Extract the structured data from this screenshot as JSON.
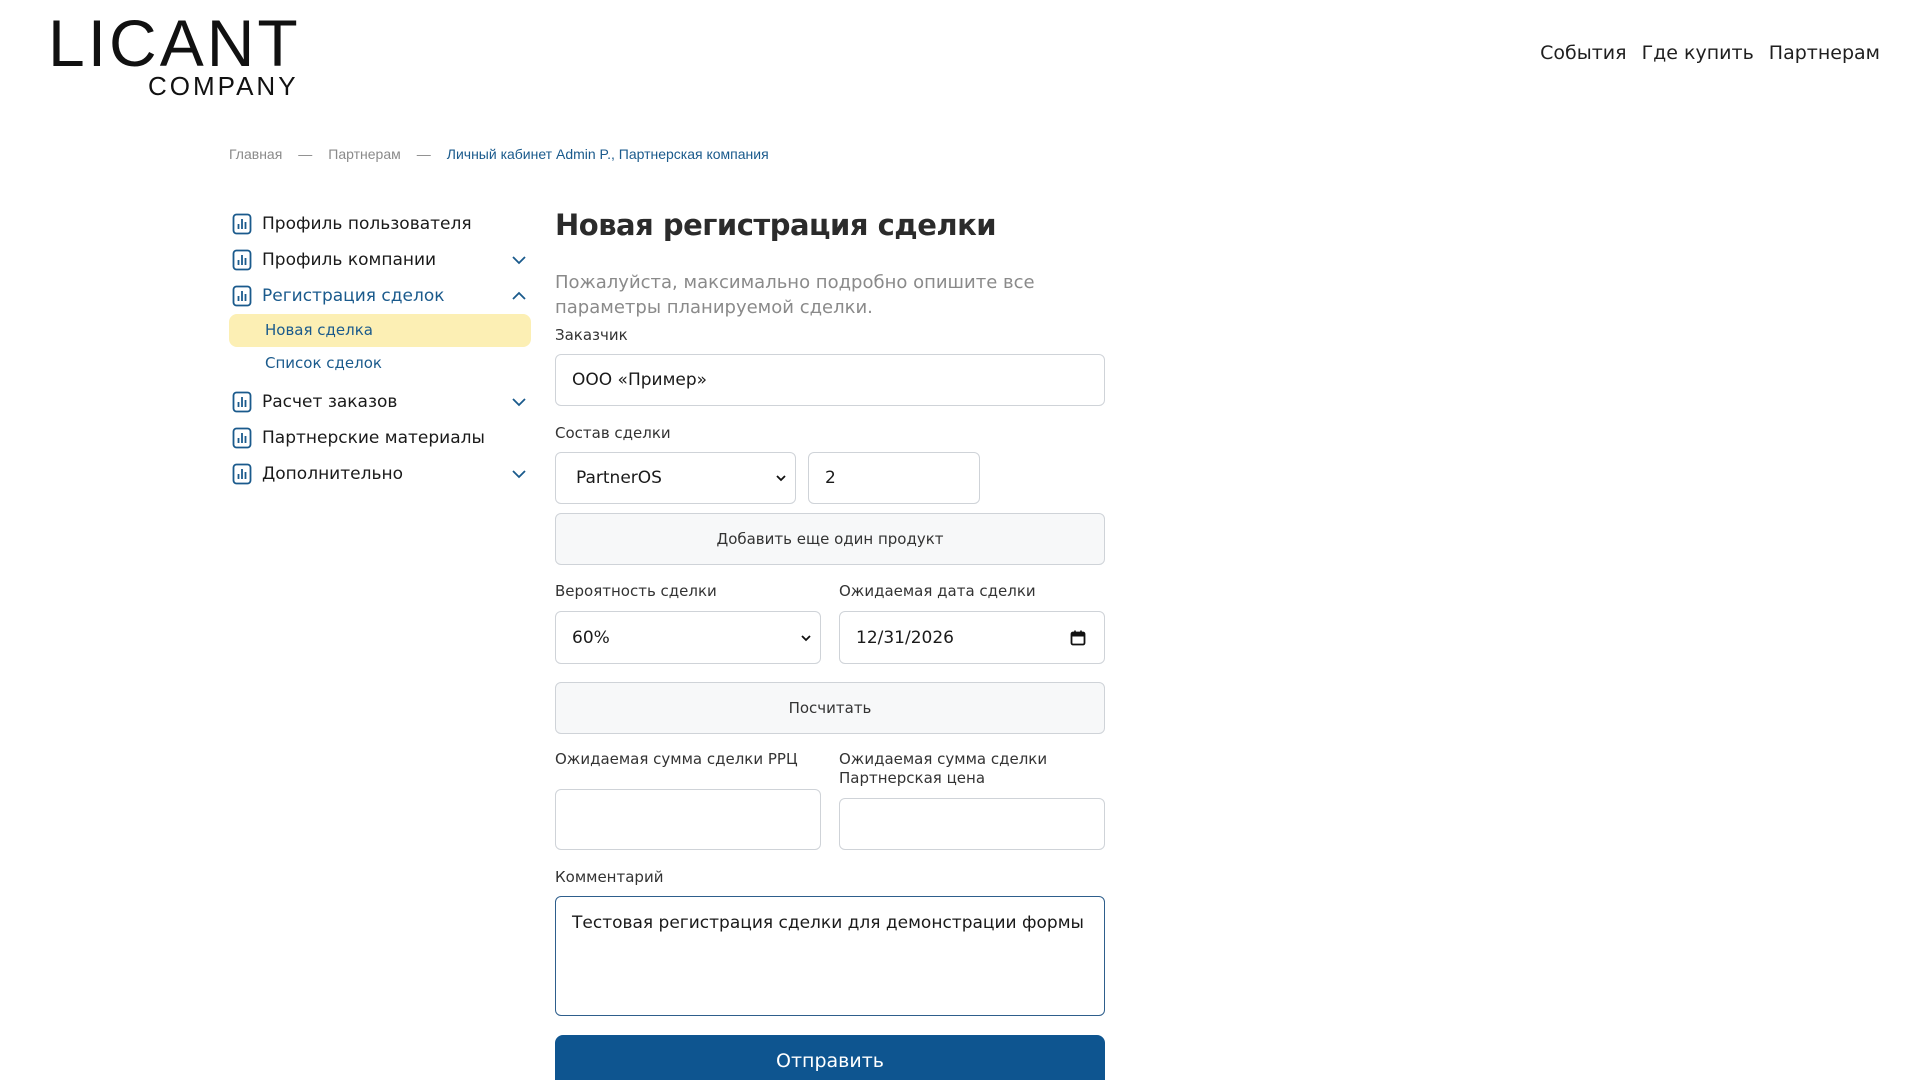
{
  "logo": {
    "main": "LICANT",
    "sub": "COMPANY"
  },
  "top_nav": {
    "events": "События",
    "where_to_buy": "Где купить",
    "partners": "Партнерам"
  },
  "breadcrumb": {
    "home": "Главная",
    "partners": "Партнерам",
    "current": "Личный кабинет Admin P., Партнерская компания",
    "separator": "—"
  },
  "sidebar": {
    "user_profile": "Профиль пользователя",
    "company_profile": "Профиль компании",
    "deal_registration": "Регистрация сделок",
    "new_deal": "Новая сделка",
    "deal_list": "Список сделок",
    "order_calc": "Расчет заказов",
    "partner_materials": "Партнерские материалы",
    "additional": "Дополнительно"
  },
  "form": {
    "title": "Новая регистрация сделки",
    "intro": "Пожалуйста, максимально подробно опишите все параметры планируемой сделки.",
    "customer_label": "Заказчик",
    "customer_value": "ООО «Пример»",
    "composition_label": "Состав сделки",
    "product_value": "PartnerOS",
    "quantity_value": "2",
    "add_product": "Добавить еще один продукт",
    "probability_label": "Вероятность сделки",
    "probability_value": "60%",
    "date_label": "Ожидаемая дата сделки",
    "date_value": "12/31/2026",
    "calculate": "Посчитать",
    "rrp_label": "Ожидаемая сумма сделки РРЦ",
    "partner_price_label": "Ожидаемая сумма сделки Партнерская цена",
    "rrp_value": "",
    "partner_price_value": "",
    "comment_label": "Комментарий",
    "comment_value": "Тестовая регистрация сделки для демонстрации формы",
    "submit": "Отправить"
  },
  "colors": {
    "accent": "#1a5a8c",
    "primary_button": "#0e5590",
    "selected_bg": "#fcefb4"
  },
  "icons": {
    "sidebar": "bar-chart-doc-icon",
    "expand": "chevron-down-icon",
    "collapse": "chevron-up-icon",
    "calendar": "calendar-icon"
  }
}
